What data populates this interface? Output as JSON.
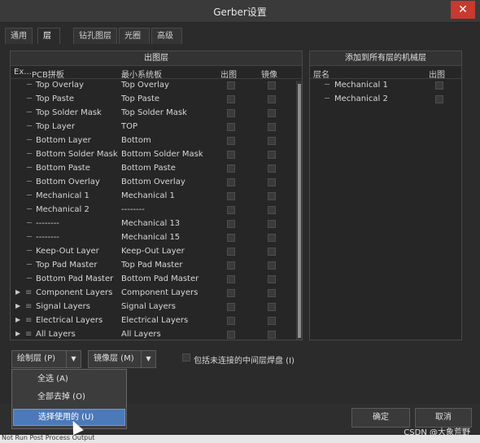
{
  "window": {
    "title": "Gerber设置",
    "close_icon": "✕"
  },
  "tabs": [
    "通用",
    "层",
    "钻孔图层",
    "光圈",
    "高级"
  ],
  "left_panel": {
    "header": "出图层",
    "columns": [
      "Ex...",
      "PCB拼板",
      "最小系统板",
      "出图",
      "镜像"
    ],
    "rows": [
      {
        "pcb": "Top Overlay",
        "board": "Top Overlay"
      },
      {
        "pcb": "Top Paste",
        "board": "Top Paste"
      },
      {
        "pcb": "Top Solder Mask",
        "board": "Top Solder Mask"
      },
      {
        "pcb": "Top Layer",
        "board": "TOP"
      },
      {
        "pcb": "Bottom Layer",
        "board": "Bottom"
      },
      {
        "pcb": "Bottom Solder Mask",
        "board": "Bottom Solder Mask"
      },
      {
        "pcb": "Bottom Paste",
        "board": "Bottom Paste"
      },
      {
        "pcb": "Bottom Overlay",
        "board": "Bottom Overlay"
      },
      {
        "pcb": "Mechanical 1",
        "board": "Mechanical 1"
      },
      {
        "pcb": "Mechanical 2",
        "board": "--------"
      },
      {
        "pcb": "--------",
        "board": "Mechanical 13"
      },
      {
        "pcb": "--------",
        "board": "Mechanical 15"
      },
      {
        "pcb": "Keep-Out Layer",
        "board": "Keep-Out Layer"
      },
      {
        "pcb": "Top Pad Master",
        "board": "Top Pad Master"
      },
      {
        "pcb": "Bottom Pad Master",
        "board": "Bottom Pad Master"
      }
    ],
    "group_rows": [
      {
        "pcb": "Component Layers",
        "board": "Component Layers"
      },
      {
        "pcb": "Signal Layers",
        "board": "Signal Layers"
      },
      {
        "pcb": "Electrical Layers",
        "board": "Electrical Layers"
      },
      {
        "pcb": "All Layers",
        "board": "All Layers"
      }
    ]
  },
  "right_panel": {
    "header": "添加到所有层的机械层",
    "columns": [
      "层名",
      "出图"
    ],
    "rows": [
      "Mechanical 1",
      "Mechanical 2"
    ]
  },
  "controls": {
    "plot_layers_button": "绘制层 (P)",
    "mirror_layers_button": "镜像层 (M)",
    "include_unconnected_label": "包括未连接的中间层焊盘 (I)"
  },
  "dropdown_menu": {
    "items": [
      "全选 (A)",
      "全部去掉 (O)",
      "选择使用的 (U)"
    ],
    "selected_index": 2
  },
  "footer": {
    "ok_button": "确定",
    "cancel_button": "取消"
  },
  "status_bar": "Not Run  Post Process  Output",
  "watermark": "CSDN @大象荒野"
}
